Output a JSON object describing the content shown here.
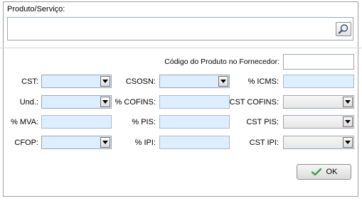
{
  "produto": {
    "label": "Produto/Serviço:",
    "value": ""
  },
  "codigo_fornecedor": {
    "label": "Código do Produto no Fornecedor:",
    "value": ""
  },
  "fields": {
    "cst": {
      "label": "CST:",
      "value": ""
    },
    "und": {
      "label": "Und.:",
      "value": ""
    },
    "mva": {
      "label": "% MVA:",
      "value": ""
    },
    "cfop": {
      "label": "CFOP:",
      "value": ""
    },
    "csosn": {
      "label": "CSOSN:",
      "value": ""
    },
    "cofins": {
      "label": "% COFINS:",
      "value": ""
    },
    "pis": {
      "label": "% PIS:",
      "value": ""
    },
    "ipi": {
      "label": "% IPI:",
      "value": ""
    },
    "icms": {
      "label": "% ICMS:",
      "value": ""
    },
    "cst_cofins": {
      "label": "CST COFINS:",
      "value": ""
    },
    "cst_pis": {
      "label": "CST PIS:",
      "value": ""
    },
    "cst_ipi": {
      "label": "CST IPI:",
      "value": ""
    }
  },
  "ok_button": {
    "label": "OK"
  },
  "icons": {
    "search": "magnifier-icon",
    "ok": "checkmark-icon",
    "dropdown": "chevron-down-icon"
  },
  "colors": {
    "input_bg": "#ddeeff",
    "ok_check": "#3aa33a"
  }
}
